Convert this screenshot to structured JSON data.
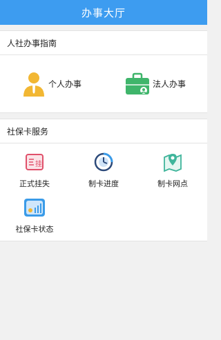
{
  "header": {
    "title": "办事大厅"
  },
  "guide": {
    "title": "人社办事指南",
    "items": [
      {
        "label": "个人办事",
        "icon": "person-icon"
      },
      {
        "label": "法人办事",
        "icon": "briefcase-icon"
      }
    ]
  },
  "card": {
    "title": "社保卡服务",
    "items": [
      {
        "label": "正式挂失",
        "icon": "report-loss-icon"
      },
      {
        "label": "制卡进度",
        "icon": "progress-icon"
      },
      {
        "label": "制卡网点",
        "icon": "map-pin-icon"
      },
      {
        "label": "社保卡状态",
        "icon": "card-status-icon"
      }
    ]
  },
  "colors": {
    "header": "#3d9cf0",
    "person": "#f2b733",
    "briefcase": "#3fb56b",
    "loss": "#e0506a",
    "progress": "#2c4a7a",
    "map": "#3fb59b",
    "status": "#3a9be8"
  }
}
